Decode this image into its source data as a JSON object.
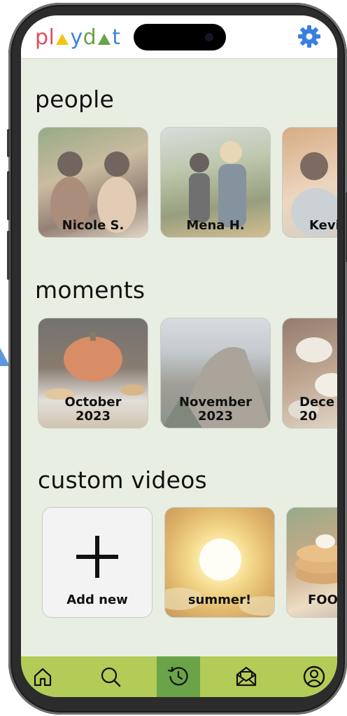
{
  "app": {
    "logo_letters": [
      {
        "ch": "p",
        "color": "#e24b5f"
      },
      {
        "ch": "l",
        "color": "#e24b5f"
      },
      {
        "ch": "▲",
        "color": "#f2c417"
      },
      {
        "ch": "y",
        "color": "#3f86d8"
      },
      {
        "ch": "d",
        "color": "#6aa348"
      },
      {
        "ch": "▲",
        "color": "#6aa348"
      },
      {
        "ch": "t",
        "color": "#3f86d8"
      }
    ],
    "settings_icon": "gear-icon",
    "accent_colors": {
      "gear": "#3a7fe0",
      "navbar": "#b3cb57",
      "nav_active": "#6aa348",
      "background": "#e9eee2"
    }
  },
  "sections": {
    "people": {
      "title": "people",
      "cards": [
        {
          "label": "Nicole S."
        },
        {
          "label": "Mena H."
        },
        {
          "label": "Kevi"
        }
      ]
    },
    "moments": {
      "title": "moments",
      "cards": [
        {
          "label": "October\n2023"
        },
        {
          "label": "November\n2023"
        },
        {
          "label": "Dece\n20"
        }
      ]
    },
    "custom_videos": {
      "title": "custom videos",
      "cards": [
        {
          "label": "Add new"
        },
        {
          "label": "summer!"
        },
        {
          "label": "FOO"
        }
      ]
    }
  },
  "nav": {
    "items": [
      {
        "icon": "home-icon"
      },
      {
        "icon": "search-icon"
      },
      {
        "icon": "history-icon",
        "active": true
      },
      {
        "icon": "inbox-icon"
      },
      {
        "icon": "profile-icon"
      }
    ]
  }
}
